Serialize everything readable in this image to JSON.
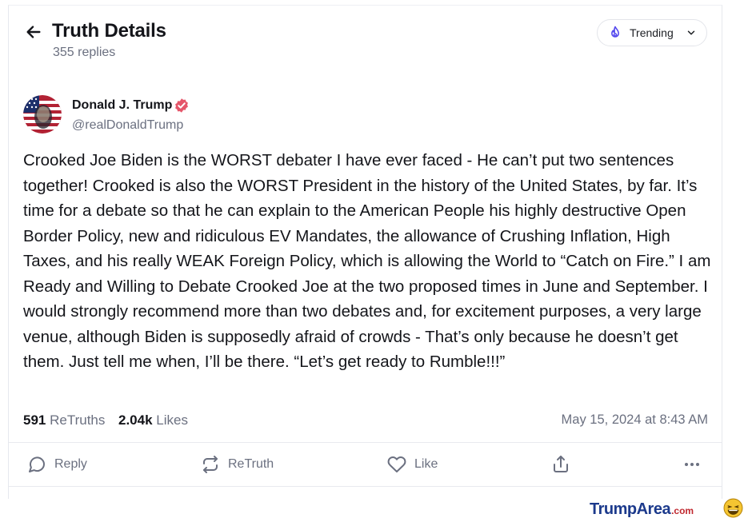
{
  "header": {
    "title": "Truth Details",
    "replies": "355 replies",
    "trending_label": "Trending"
  },
  "author": {
    "name": "Donald J. Trump",
    "handle": "@realDonaldTrump"
  },
  "post": {
    "text": "Crooked Joe Biden is the WORST debater I have ever faced - He can’t put two sentences together! Crooked is also the WORST President in the history of the United States, by far. It’s time for a debate so that he can explain to the American People his highly destructive Open Border Policy, new and ridiculous EV Mandates, the allowance of Crushing Inflation, High Taxes, and his really WEAK Foreign Policy, which is allowing the World to “Catch on Fire.” I am Ready and Willing to Debate Crooked Joe at the two proposed times in June and September. I would strongly recommend more than two debates and, for excitement purposes, a very large venue, although Biden is supposedly afraid of crowds - That’s only because he doesn’t get them. Just tell me when, I’ll be there. “Let’s get ready to Rumble!!!”"
  },
  "stats": {
    "retruths_count": "591",
    "retruths_label": "ReTruths",
    "likes_count": "2.04k",
    "likes_label": "Likes",
    "date": "May 15, 2024 at 8:43 AM"
  },
  "actions": {
    "reply": "Reply",
    "retruth": "ReTruth",
    "like": "Like"
  },
  "watermark": {
    "brand": "TrumpArea",
    "domain": ".com"
  },
  "colors": {
    "verified": "#e5566a",
    "trending_icon": "#5448ee",
    "brand": "#1c3a8c",
    "muted": "#6b7080"
  }
}
